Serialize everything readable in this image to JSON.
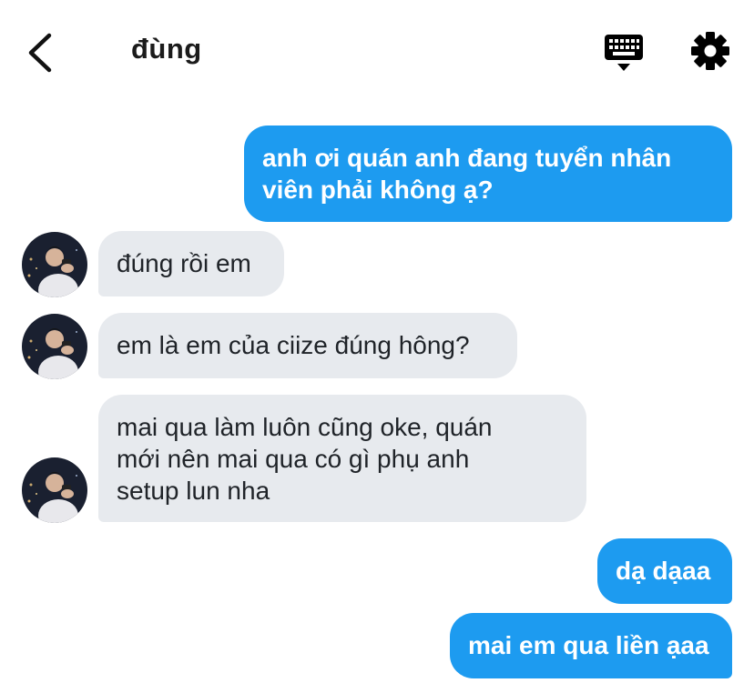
{
  "header": {
    "title": "đùng",
    "back_icon": "chevron-left-icon",
    "keyboard_icon": "keyboard-icon",
    "settings_icon": "gear-icon"
  },
  "messages": [
    {
      "direction": "outgoing",
      "text": "anh ơi quán anh đang tuyển nhân\nviên phải không ạ?"
    },
    {
      "direction": "incoming",
      "text": "đúng rồi em"
    },
    {
      "direction": "incoming",
      "text": "em là em của ciize đúng hông?"
    },
    {
      "direction": "incoming",
      "text": "mai qua làm luôn cũng oke, quán\nmới nên mai qua có gì phụ anh\nsetup lun nha"
    },
    {
      "direction": "outgoing",
      "text": "dạ dạaa"
    },
    {
      "direction": "outgoing",
      "text": "mai em qua liền ạaa"
    }
  ],
  "colors": {
    "outgoing_bubble": "#1d9bf0",
    "incoming_bubble": "#e7eaee",
    "icon": "#000000"
  }
}
